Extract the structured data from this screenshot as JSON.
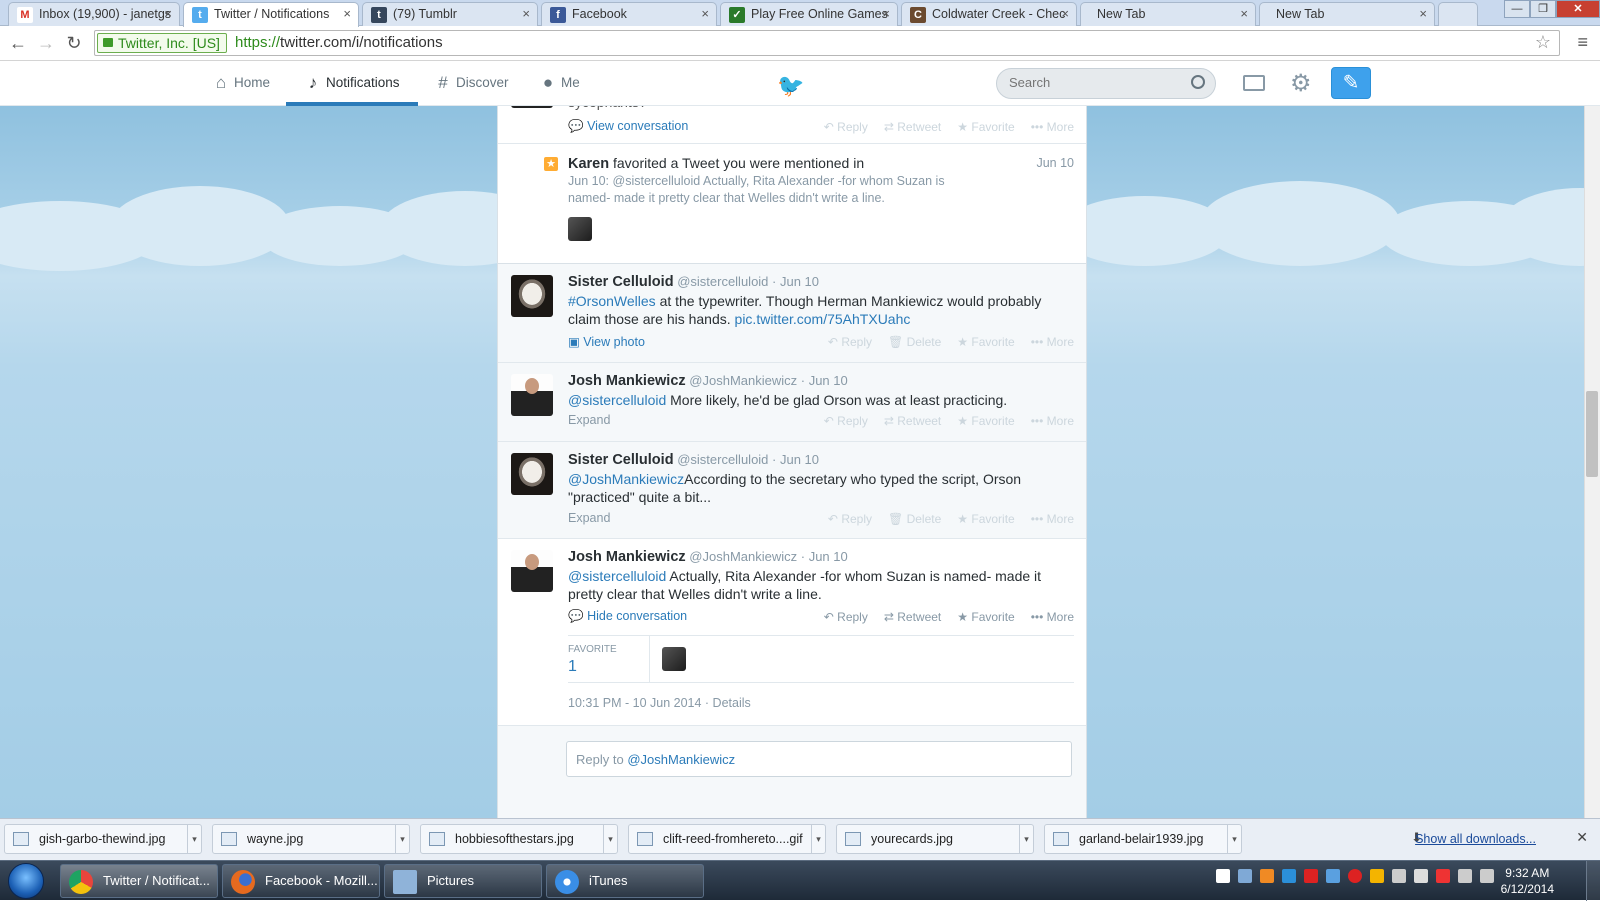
{
  "browser": {
    "tabs": [
      {
        "title": "Inbox (19,900) - janetgs",
        "icon": "gmail-icon",
        "color": "#d93025",
        "glyph": "M"
      },
      {
        "title": "Twitter / Notifications",
        "icon": "twitter-icon",
        "color": "#55acee",
        "glyph": "t"
      },
      {
        "title": "(79) Tumblr",
        "icon": "tumblr-icon",
        "color": "#35465c",
        "glyph": "t"
      },
      {
        "title": "Facebook",
        "icon": "facebook-icon",
        "color": "#3b5998",
        "glyph": "f"
      },
      {
        "title": "Play Free Online Games",
        "icon": "games-icon",
        "color": "#2a7a2a",
        "glyph": "✓"
      },
      {
        "title": "Coldwater Creek - Chec",
        "icon": "coldwater-icon",
        "color": "#6b4a2f",
        "glyph": "C"
      },
      {
        "title": "New Tab",
        "icon": "",
        "color": "",
        "glyph": ""
      },
      {
        "title": "New Tab",
        "icon": "",
        "color": "",
        "glyph": ""
      }
    ],
    "ev_label": "Twitter, Inc. [US]",
    "url_scheme": "https://",
    "url_rest": "twitter.com/i/notifications"
  },
  "twitter_nav": {
    "home": "Home",
    "notifications": "Notifications",
    "discover": "Discover",
    "me": "Me",
    "search_placeholder": "Search"
  },
  "stream": {
    "top_fragment": "sycophants?",
    "view_conversation": "View conversation",
    "notification": {
      "actor": "Karen",
      "action": "favorited a Tweet you were mentioned in",
      "date": "Jun 10",
      "quote_prefix": "Jun 10:",
      "quote_mention": "@sistercelluloid",
      "quote_text": "Actually, Rita Alexander -for whom Suzan is named- made it pretty clear that Welles didn't write a line."
    },
    "tweets": [
      {
        "name": "Sister Celluloid",
        "handle": "@sistercelluloid",
        "date": "· Jun 10",
        "mention": "#OrsonWelles",
        "text": "at the typewriter. Though Herman Mankiewicz would probably claim those are his hands.",
        "link": "pic.twitter.com/75AhTXUahc",
        "sub": "View photo",
        "actions": [
          "Reply",
          "Delete",
          "Favorite",
          "More"
        ]
      },
      {
        "name": "Josh Mankiewicz",
        "handle": "@JoshMankiewicz",
        "date": "· Jun 10",
        "mention": "@sistercelluloid",
        "text": "More likely, he'd be glad Orson was at least practicing.",
        "link": "",
        "sub": "Expand",
        "actions": [
          "Reply",
          "Retweet",
          "Favorite",
          "More"
        ]
      },
      {
        "name": "Sister Celluloid",
        "handle": "@sistercelluloid",
        "date": "· Jun 10",
        "mention": "@JoshMankiewicz",
        "text": "According to the secretary who typed the script, Orson \"practiced\" quite a bit...",
        "link": "",
        "sub": "Expand",
        "actions": [
          "Reply",
          "Delete",
          "Favorite",
          "More"
        ]
      },
      {
        "name": "Josh Mankiewicz",
        "handle": "@JoshMankiewicz",
        "date": "· Jun 10",
        "mention": "@sistercelluloid",
        "text": "Actually, Rita Alexander -for whom Suzan is named- made it pretty clear that Welles didn't write a line.",
        "link": "",
        "sub": "Hide conversation",
        "actions": [
          "Reply",
          "Retweet",
          "Favorite",
          "More"
        ]
      }
    ],
    "top_actions": [
      "Reply",
      "Retweet",
      "Favorite",
      "More"
    ],
    "favorite_label": "FAVORITE",
    "favorite_count": "1",
    "timestamp": "10:31 PM - 10 Jun 2014",
    "details": "· Details",
    "reply_prefix": "Reply to",
    "reply_handle": "@JoshMankiewicz"
  },
  "downloads": {
    "files": [
      "gish-garbo-thewind.jpg",
      "wayne.jpg",
      "hobbiesofthestars.jpg",
      "clift-reed-fromhereto....gif",
      "yourecards.jpg",
      "garland-belair1939.jpg"
    ],
    "show_all": "Show all downloads..."
  },
  "taskbar": {
    "items": [
      {
        "label": "Twitter / Notificat...",
        "color": "#e8453c"
      },
      {
        "label": "Facebook - Mozill...",
        "color": "#e66a1f"
      },
      {
        "label": "Pictures",
        "color": "#8fb3d9"
      },
      {
        "label": "iTunes",
        "color": "#3a8ee6"
      }
    ],
    "time": "9:32 AM",
    "date": "6/12/2014"
  }
}
